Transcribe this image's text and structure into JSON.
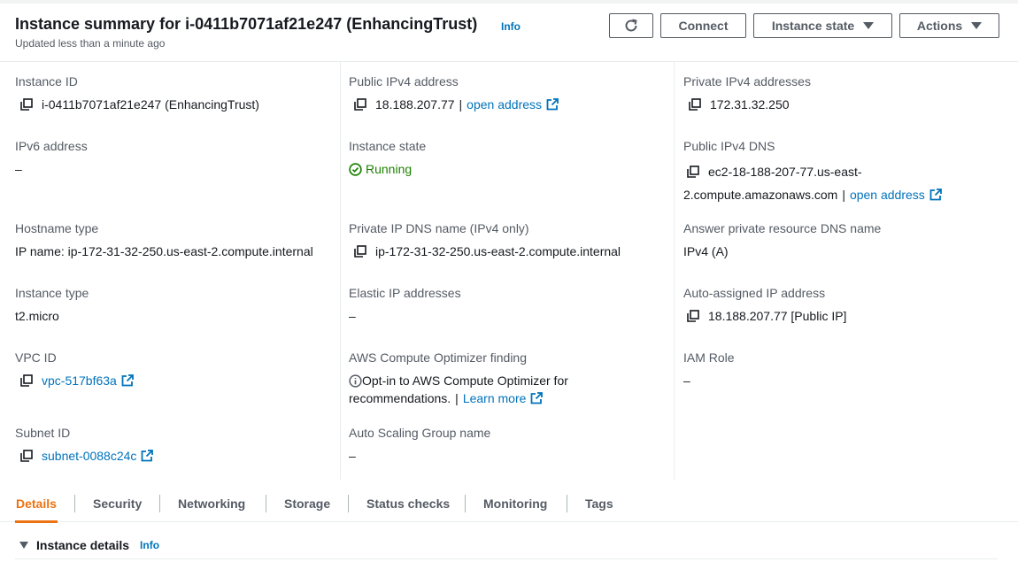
{
  "header": {
    "title": "Instance summary for i-0411b7071af21e247 (EnhancingTrust)",
    "info": "Info",
    "subtitle": "Updated less than a minute ago",
    "buttons": {
      "connect": "Connect",
      "instance_state": "Instance state",
      "actions": "Actions"
    }
  },
  "fields": {
    "instance_id": {
      "label": "Instance ID",
      "value": "i-0411b7071af21e247 (EnhancingTrust)"
    },
    "public_ipv4": {
      "label": "Public IPv4 address",
      "value": "18.188.207.77",
      "separator": "|",
      "link": "open address"
    },
    "private_ipv4": {
      "label": "Private IPv4 addresses",
      "value": "172.31.32.250"
    },
    "ipv6": {
      "label": "IPv6 address",
      "value": "–"
    },
    "instance_state": {
      "label": "Instance state",
      "value": "Running"
    },
    "public_dns": {
      "label": "Public IPv4 DNS",
      "value_line1": "ec2-18-188-207-77.us-east-",
      "value_line2": "2.compute.amazonaws.com",
      "separator": "|",
      "link": "open address"
    },
    "hostname_type": {
      "label": "Hostname type",
      "value": "IP name: ip-172-31-32-250.us-east-2.compute.internal"
    },
    "private_dns": {
      "label": "Private IP DNS name (IPv4 only)",
      "value": "ip-172-31-32-250.us-east-2.compute.internal"
    },
    "answer_dns": {
      "label": "Answer private resource DNS name",
      "value": "IPv4 (A)"
    },
    "instance_type": {
      "label": "Instance type",
      "value": "t2.micro"
    },
    "elastic_ip": {
      "label": "Elastic IP addresses",
      "value": "–"
    },
    "auto_ip": {
      "label": "Auto-assigned IP address",
      "value": "18.188.207.77 [Public IP]"
    },
    "vpc_id": {
      "label": "VPC ID",
      "value": "vpc-517bf63a"
    },
    "optimizer": {
      "label": "AWS Compute Optimizer finding",
      "line1": "Opt-in to AWS Compute Optimizer for",
      "line2": "recommendations.",
      "separator": "|",
      "link": "Learn more"
    },
    "iam_role": {
      "label": "IAM Role",
      "value": "–"
    },
    "subnet_id": {
      "label": "Subnet ID",
      "value": "subnet-0088c24c"
    },
    "asg_name": {
      "label": "Auto Scaling Group name",
      "value": "–"
    }
  },
  "tabs": [
    "Details",
    "Security",
    "Networking",
    "Storage",
    "Status checks",
    "Monitoring",
    "Tags"
  ],
  "active_tab": "Details",
  "section": {
    "title": "Instance details",
    "info": "Info"
  },
  "colors": {
    "link": "#0073bb",
    "active_tab": "#ec7211",
    "running": "#1d8102",
    "label": "#545b64"
  }
}
